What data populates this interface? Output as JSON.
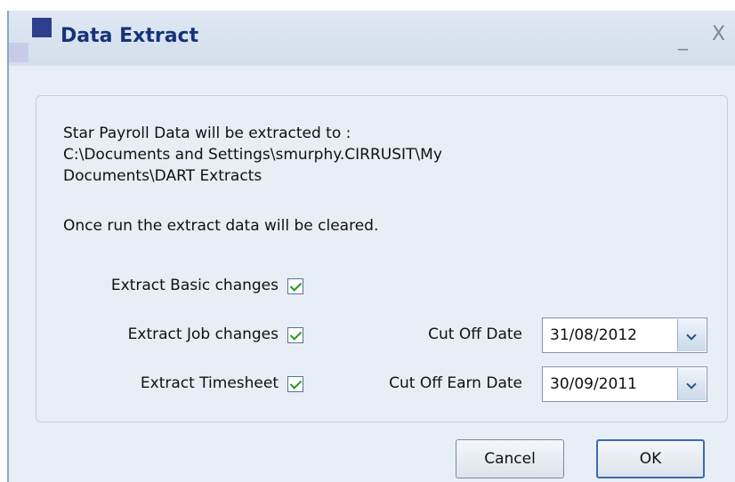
{
  "window": {
    "title": "Data Extract",
    "minimize": "_",
    "close": "X"
  },
  "message": {
    "line1": "Star Payroll Data will be extracted to :",
    "line2": "C:\\Documents and Settings\\smurphy.CIRRUSIT\\My",
    "line3": "Documents\\DART Extracts",
    "note": "Once run the extract data will be cleared."
  },
  "options": [
    {
      "label": "Extract Basic changes",
      "checked": true
    },
    {
      "label": "Extract Job changes",
      "checked": true
    },
    {
      "label": "Extract Timesheet",
      "checked": true
    }
  ],
  "dates": [
    {
      "label": "Cut Off Date",
      "value": "31/08/2012"
    },
    {
      "label": "Cut Off Earn Date",
      "value": "30/09/2011"
    }
  ],
  "buttons": {
    "cancel": "Cancel",
    "ok": "OK"
  }
}
